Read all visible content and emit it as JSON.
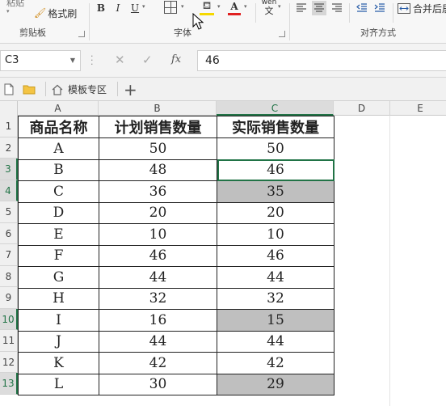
{
  "ribbon": {
    "paste_label": "粘贴",
    "format_painter_label": "格式刷",
    "clipboard_group": "剪贴板",
    "font_group": "字体",
    "alignment_group": "对齐方式",
    "bold": "B",
    "italic": "I",
    "underline": "U",
    "font_color_letter": "A",
    "phonetic_top": "wén",
    "phonetic_bottom": "文",
    "merge_label": "合并后居",
    "accent_red": "#e02020",
    "fill_yellow": "#f5d800"
  },
  "formula_bar": {
    "name_box": "C3",
    "value": "46",
    "cancel_icon": "✕",
    "enter_icon": "✓",
    "fx_label": "fx"
  },
  "tabbar": {
    "template_tab": "模板专区",
    "add": "+"
  },
  "columns": [
    "A",
    "B",
    "C",
    "D",
    "E"
  ],
  "rows": [
    "1",
    "2",
    "3",
    "4",
    "5",
    "6",
    "7",
    "8",
    "9",
    "10",
    "11",
    "12",
    "13"
  ],
  "table": {
    "headers": [
      "商品名称",
      "计划销售数量",
      "实际销售数量"
    ],
    "rows": [
      [
        "A",
        "50",
        "50"
      ],
      [
        "B",
        "48",
        "46"
      ],
      [
        "C",
        "36",
        "35"
      ],
      [
        "D",
        "20",
        "20"
      ],
      [
        "E",
        "10",
        "10"
      ],
      [
        "F",
        "46",
        "46"
      ],
      [
        "G",
        "44",
        "44"
      ],
      [
        "H",
        "32",
        "32"
      ],
      [
        "I",
        "16",
        "15"
      ],
      [
        "J",
        "44",
        "44"
      ],
      [
        "K",
        "42",
        "42"
      ],
      [
        "L",
        "30",
        "29"
      ]
    ]
  },
  "selection_color": "#217346",
  "shade_color": "#bfbfbf"
}
